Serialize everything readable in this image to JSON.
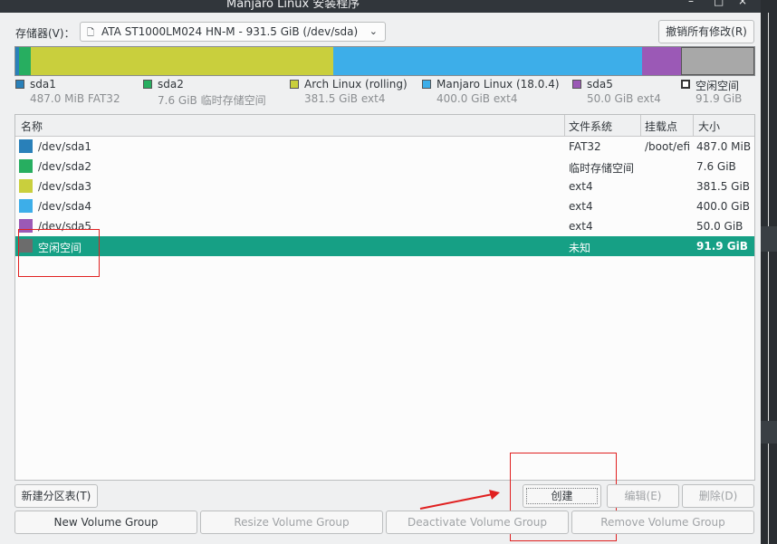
{
  "window": {
    "title": "Manjaro Linux 安装程序",
    "minimize_glyph": "–",
    "maximize_glyph": "□",
    "close_glyph": "×"
  },
  "storage": {
    "label": "存储器(V)：",
    "device": "ATA ST1000LM024 HN-M - 931.5 GiB (/dev/sda)",
    "device_icon": "drive-icon",
    "revert_label": "撤销所有修改(R)"
  },
  "partition_bar": [
    {
      "name": "sda1",
      "fraction": 0.0005,
      "color": "#2980b9"
    },
    {
      "name": "sda2",
      "fraction": 0.0082,
      "color": "#27ae60"
    },
    {
      "name": "sda3",
      "fraction": 0.4095,
      "color": "#c9cf3d"
    },
    {
      "name": "sda4",
      "fraction": 0.4294,
      "color": "#3daee9"
    },
    {
      "name": "sda5",
      "fraction": 0.0537,
      "color": "#9b59b6"
    },
    {
      "name": "free",
      "fraction": 0.0987,
      "color": "#a8a8a8"
    }
  ],
  "legend": [
    {
      "name": "sda1",
      "info": "487.0 MiB  FAT32",
      "color": "#2980b9"
    },
    {
      "name": "sda2",
      "info": "7.6 GiB  临时存储空间",
      "color": "#27ae60"
    },
    {
      "name": "Arch Linux (rolling)",
      "info": "381.5 GiB  ext4",
      "color": "#c9cf3d"
    },
    {
      "name": "Manjaro Linux (18.0.4)",
      "info": "400.0 GiB  ext4",
      "color": "#3daee9"
    },
    {
      "name": "sda5",
      "info": "50.0 GiB  ext4",
      "color": "#9b59b6"
    },
    {
      "name": "空闲空间",
      "info": "91.9 GiB",
      "color": "#ffffff"
    }
  ],
  "table": {
    "headers": {
      "name": "名称",
      "fs": "文件系统",
      "mount": "挂载点",
      "size": "大小"
    },
    "rows": [
      {
        "name": "/dev/sda1",
        "fs": "FAT32",
        "mount": "/boot/efi",
        "size": "487.0 MiB",
        "color": "#2980b9"
      },
      {
        "name": "/dev/sda2",
        "fs": "临时存储空间",
        "mount": "",
        "size": "7.6 GiB",
        "color": "#27ae60"
      },
      {
        "name": "/dev/sda3",
        "fs": "ext4",
        "mount": "",
        "size": "381.5 GiB",
        "color": "#c9cf3d"
      },
      {
        "name": "/dev/sda4",
        "fs": "ext4",
        "mount": "",
        "size": "400.0 GiB",
        "color": "#3daee9"
      },
      {
        "name": "/dev/sda5",
        "fs": "ext4",
        "mount": "",
        "size": "50.0 GiB",
        "color": "#9b59b6"
      },
      {
        "name": "空闲空间",
        "fs": "未知",
        "mount": "",
        "size": "91.9 GiB",
        "color": "#6c6c6c"
      }
    ],
    "selected_index": 5
  },
  "buttons": {
    "new_table": "新建分区表(T)",
    "create": "创建",
    "edit": "编辑(E)",
    "delete": "删除(D)",
    "new_vg": "New Volume Group",
    "resize_vg": "Resize Volume Group",
    "deactivate_vg": "Deactivate Volume Group",
    "remove_vg": "Remove Volume Group"
  },
  "colors": {
    "selection": "#16a085",
    "annotation": "#e02020"
  }
}
